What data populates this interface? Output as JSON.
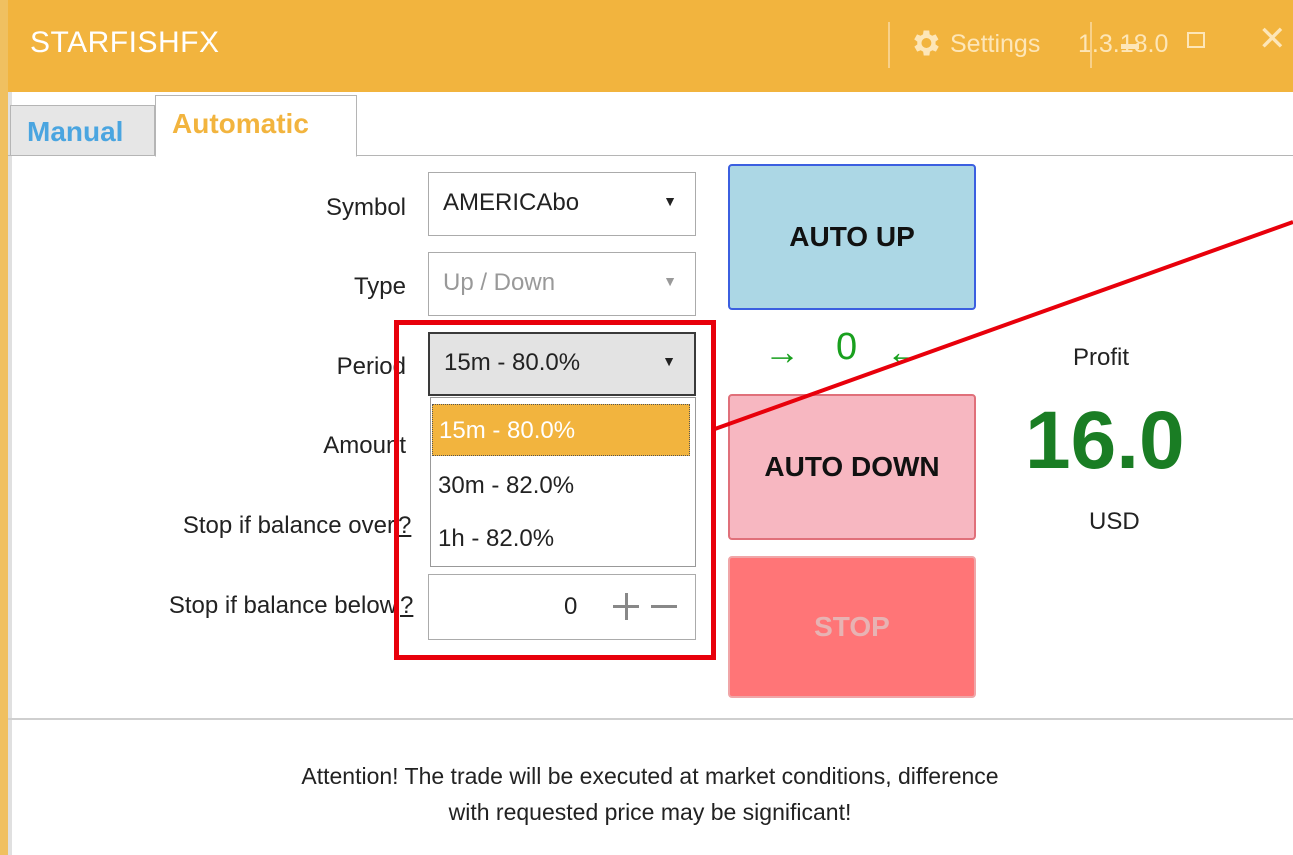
{
  "window": {
    "title": "STARFISHFX",
    "version": "1.3.18.0",
    "settings_label": "Settings",
    "close_glyph": "✕"
  },
  "tabs": [
    {
      "label": "Manual",
      "active": false
    },
    {
      "label": "Automatic",
      "active": true
    }
  ],
  "form": {
    "symbol": {
      "label": "Symbol",
      "value": "AMERICAbo"
    },
    "type": {
      "label": "Type",
      "value": "Up / Down",
      "disabled": true
    },
    "period": {
      "label": "Period",
      "value": "15m - 80.0%",
      "options": [
        "15m - 80.0%",
        "30m - 82.0%",
        "1h - 82.0%"
      ],
      "highlighted_option": "15m - 80.0%"
    },
    "amount": {
      "label": "Amount"
    },
    "stop_over": {
      "label": "Stop if balance over",
      "help": "?"
    },
    "stop_below": {
      "label": "Stop if balance below",
      "help": "?",
      "value": "0"
    }
  },
  "buttons": {
    "auto_up": "AUTO UP",
    "auto_down": "AUTO DOWN",
    "stop": "STOP"
  },
  "counter": {
    "left_arrow": "→",
    "value": "0",
    "right_arrow": "←"
  },
  "profit": {
    "label": "Profit",
    "value": "16.0",
    "currency": "USD"
  },
  "notice": {
    "line1": "Attention! The trade will be executed at market conditions, difference",
    "line2": "with requested price may be significant!"
  },
  "colors": {
    "titlebar": "#f2b43e",
    "manual_tab": "#4aa5e0",
    "auto_up_bg": "#acd7e5",
    "auto_down_bg": "#f7b7c1",
    "stop_bg": "#ff7577",
    "profit": "#1a7d24",
    "annotation": "#e8000b"
  }
}
